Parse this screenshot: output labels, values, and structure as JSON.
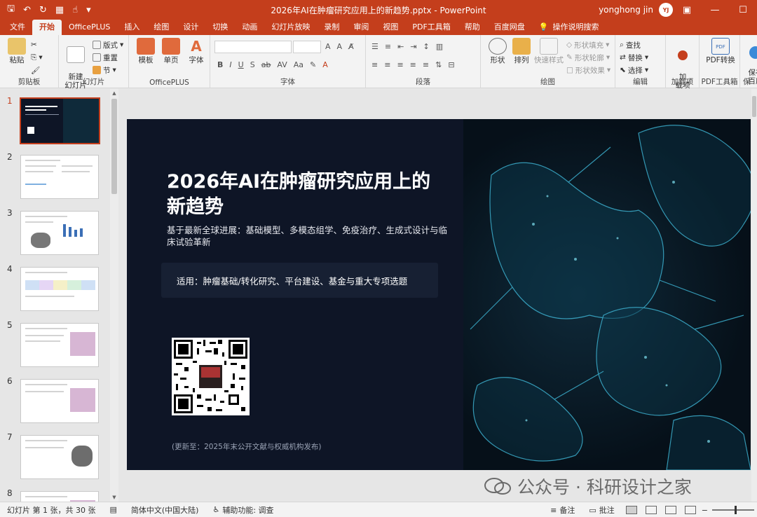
{
  "window": {
    "title": "2026年AI在肿瘤研究应用上的新趋势.pptx  -  PowerPoint",
    "user_name": "yonghong jin",
    "user_initials": "YJ"
  },
  "tabs": [
    "文件",
    "开始",
    "OfficePLUS",
    "插入",
    "绘图",
    "设计",
    "切换",
    "动画",
    "幻灯片放映",
    "录制",
    "审阅",
    "视图",
    "PDF工具箱",
    "帮助",
    "百度网盘"
  ],
  "active_tab": "开始",
  "tell_me": "操作说明搜索",
  "ribbon": {
    "clipboard": {
      "label": "剪贴板",
      "paste": "粘贴"
    },
    "slides": {
      "label": "幻灯片",
      "new_slide": "新建\n幻灯片",
      "layout": "版式",
      "reset": "重置",
      "section": "节"
    },
    "officeplus": {
      "label": "OfficePLUS",
      "template": "模板",
      "single": "单页",
      "font": "字体"
    },
    "font": {
      "label": "字体"
    },
    "paragraph": {
      "label": "段落"
    },
    "drawing": {
      "label": "绘图",
      "shape": "形状",
      "arrange": "排列",
      "quick_styles": "快速样式",
      "shape_fill": "形状填充",
      "shape_outline": "形状轮廓",
      "shape_effects": "形状效果"
    },
    "editing": {
      "label": "编辑",
      "find": "查找",
      "replace": "替换",
      "select": "选择"
    },
    "addins": {
      "label": "加载项",
      "btn": "加\n载项"
    },
    "pdf": {
      "label": "PDF工具箱",
      "btn": "PDF转换"
    },
    "save": {
      "label": "保",
      "btn": "保存\n百度"
    }
  },
  "thumbnails": [
    "1",
    "2",
    "3",
    "4",
    "5",
    "6",
    "7",
    "8"
  ],
  "slide": {
    "title": "2026年AI在肿瘤研究应用上的新趋势",
    "subtitle": "基于最新全球进展：基础模型、多模态组学、免疫治疗、生成式设计与临床试验革新",
    "box_text": "适用：肿瘤基础/转化研究、平台建设、基金与重大专项选题",
    "note": "(更新至：2025年末公开文献与权威机构发布)"
  },
  "watermark": "公众号 · 科研设计之家",
  "status": {
    "slide_count": "幻灯片 第 1 张，共 30 张",
    "language": "简体中文(中国大陆)",
    "accessibility": "辅助功能: 调查",
    "notes": "备注",
    "comments": "批注"
  },
  "colors": {
    "accent": "#c43e1c",
    "slide_bg": "#0e1526"
  }
}
